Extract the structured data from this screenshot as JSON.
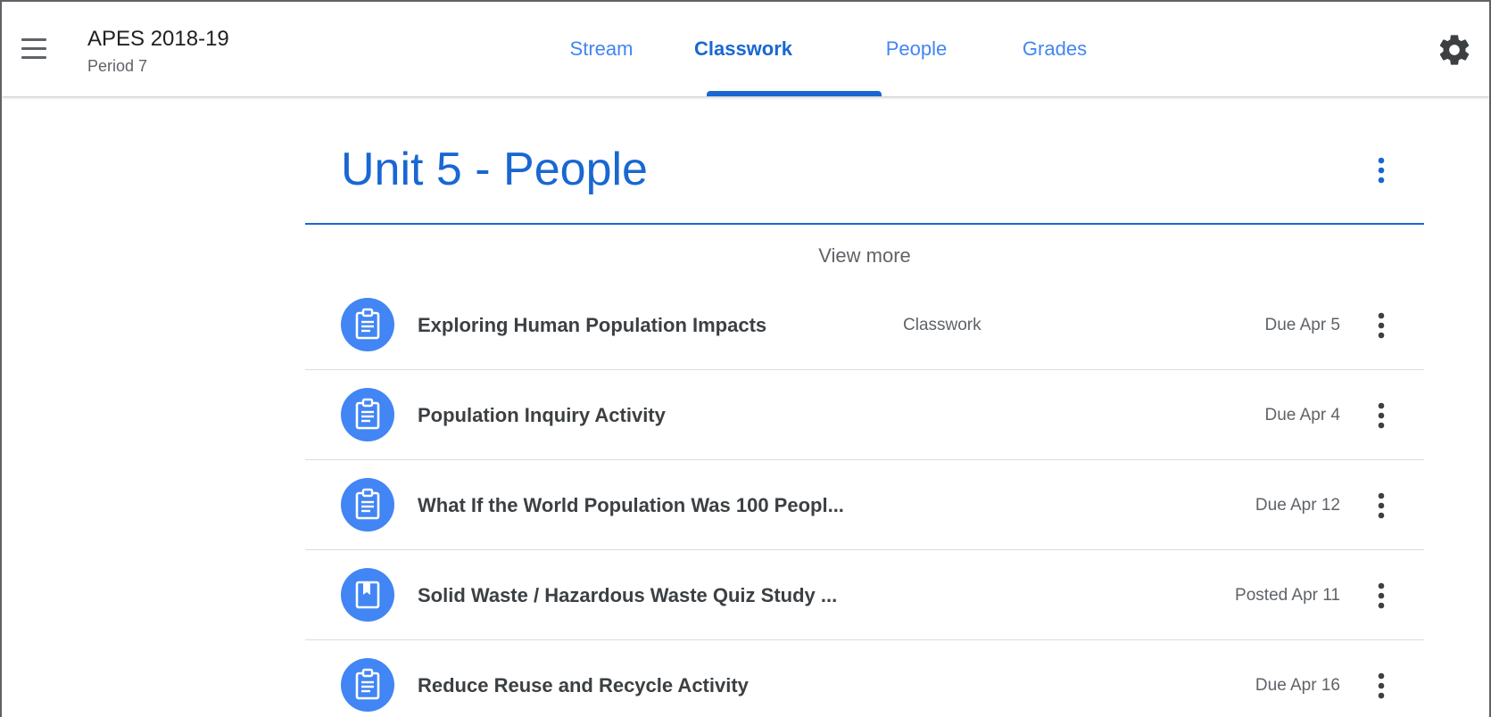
{
  "header": {
    "menu_icon": "hamburger-menu-icon",
    "class_name": "APES 2018-19",
    "section": "Period 7",
    "tabs": [
      {
        "label": "Stream",
        "active": false
      },
      {
        "label": "Classwork",
        "active": true
      },
      {
        "label": "People",
        "active": false
      },
      {
        "label": "Grades",
        "active": false
      }
    ],
    "settings_icon": "gear-icon"
  },
  "topic": {
    "title": "Unit 5 - People",
    "menu_icon": "more-vert-icon",
    "view_more_label": "View more"
  },
  "items": [
    {
      "icon": "assignment-icon",
      "title": "Exploring Human Population Impacts",
      "type": "Classwork",
      "date": "Due Apr 5"
    },
    {
      "icon": "assignment-icon",
      "title": "Population Inquiry Activity",
      "type": "",
      "date": "Due Apr 4"
    },
    {
      "icon": "assignment-icon",
      "title": "What If the World Population Was 100 Peopl...",
      "type": "",
      "date": "Due Apr 12"
    },
    {
      "icon": "material-icon",
      "title": "Solid Waste / Hazardous Waste Quiz Study ...",
      "type": "",
      "date": "Posted Apr 11"
    },
    {
      "icon": "assignment-icon",
      "title": "Reduce Reuse and Recycle Activity",
      "type": "",
      "date": "Due Apr 16"
    }
  ],
  "colors": {
    "primary": "#1967d2",
    "accent": "#4285f4",
    "text": "#3c4043",
    "muted": "#5f6368",
    "divider": "#dadce0"
  }
}
